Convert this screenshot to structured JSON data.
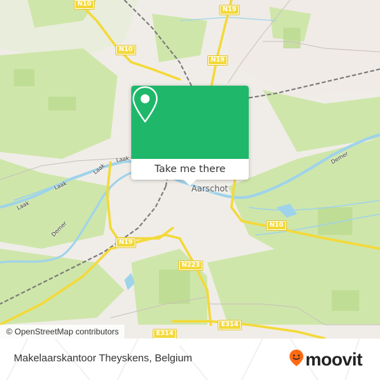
{
  "map": {
    "city_label": "Aarschot",
    "road_shields": [
      {
        "label": "N10",
        "pos": "top-left"
      },
      {
        "label": "N19",
        "pos": "top"
      },
      {
        "label": "N10",
        "pos": "upper-left"
      },
      {
        "label": "N19",
        "pos": "upper-center"
      },
      {
        "label": "N10",
        "pos": "right"
      },
      {
        "label": "N19",
        "pos": "lower-left"
      },
      {
        "label": "N223",
        "pos": "lower-center"
      },
      {
        "label": "E314",
        "pos": "bottom-center"
      },
      {
        "label": "E314",
        "pos": "bottom-left"
      }
    ],
    "river_labels": [
      "Laak",
      "Laak",
      "Laak",
      "Laak",
      "Demer",
      "Demer"
    ],
    "colors": {
      "land": "#eef2e4",
      "forest": "#c9e3a4",
      "water": "#9fd3ea",
      "road_major": "#f3d93a",
      "accent": "#1fb86b"
    }
  },
  "popup": {
    "icon": "map-pin-icon",
    "button_label": "Take me there"
  },
  "attribution": "© OpenStreetMap contributors",
  "footer": {
    "place_name": "Makelaarskantoor Theyskens, Belgium",
    "brand": "moovit",
    "brand_color": "#ff6a13"
  }
}
